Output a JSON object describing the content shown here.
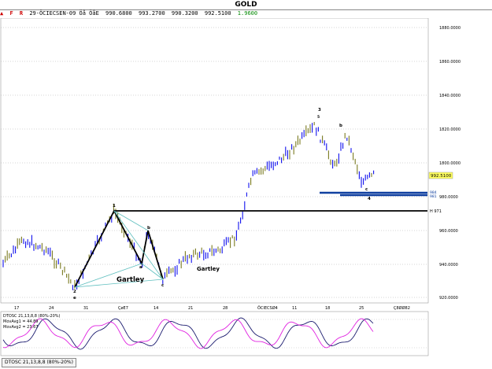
{
  "window": {
    "title": "GOLD"
  },
  "toolbar": {
    "buttons": [
      "▲",
      "F",
      "R"
    ],
    "symbol": "29-ÖCIECSEN-09 Öå ÖåE",
    "open": "990.6800",
    "high": "993.2700",
    "low": "990.3200",
    "close": "992.5100",
    "change": "1.9600"
  },
  "price_axis": {
    "labels": [
      "1880.0000",
      "1860.0000",
      "1840.0000",
      "1820.0000",
      "1800.0000",
      "980.0000",
      "960.0000",
      "940.0000",
      "920.0000"
    ],
    "current_price": "992.5100"
  },
  "date_axis": {
    "labels": [
      "17",
      "24",
      "31",
      "ÇøE7",
      "14",
      "21",
      "28",
      "ÖCIECSØ4",
      "11",
      "18",
      "25",
      "Ç8ØØ82"
    ]
  },
  "annotations": {
    "gartley_1": "Gartley",
    "gartley_2": "Gartley",
    "h_level": "H 971",
    "small_label_1": "984",
    "small_label_2": "981"
  },
  "wave_labels": {
    "top": "3",
    "b_upper": "b",
    "b_lower": "b",
    "c_upper": "c",
    "c_lower": "c",
    "e": "e",
    "a": "a",
    "d": "d",
    "one": "1",
    "two": "2",
    "four": "4",
    "five": "5"
  },
  "indicator": {
    "legend": [
      "DTOSC 21,13,8,8 (80%-20%)",
      "MovAvg1 = 44.89",
      "MovAvg2 = 23.67"
    ],
    "tab_label": "DTOSC 21,13,8,8 (80%-20%)",
    "colors": {
      "line1": "#1a1a6e",
      "line2": "#e020e0"
    }
  },
  "colors": {
    "up_bar": "#7a7a20",
    "down_bar": "#1010ee",
    "grid": "#aaaaaa",
    "fib_line": "#5fbfbf",
    "support_line": "#1040a0"
  },
  "chart_data": {
    "type": "bar",
    "title": "GOLD",
    "ylim_note": "price axis",
    "x": [
      "17",
      "24",
      "31",
      "ÇøE7",
      "14",
      "21",
      "28",
      "ÖCIECSØ4",
      "11",
      "18",
      "25"
    ],
    "series": [
      {
        "name": "",
        "values": [
          935,
          945,
          925,
          965,
          935,
          945,
          960,
          1000,
          1010,
          990,
          992.51
        ]
      }
    ]
  }
}
